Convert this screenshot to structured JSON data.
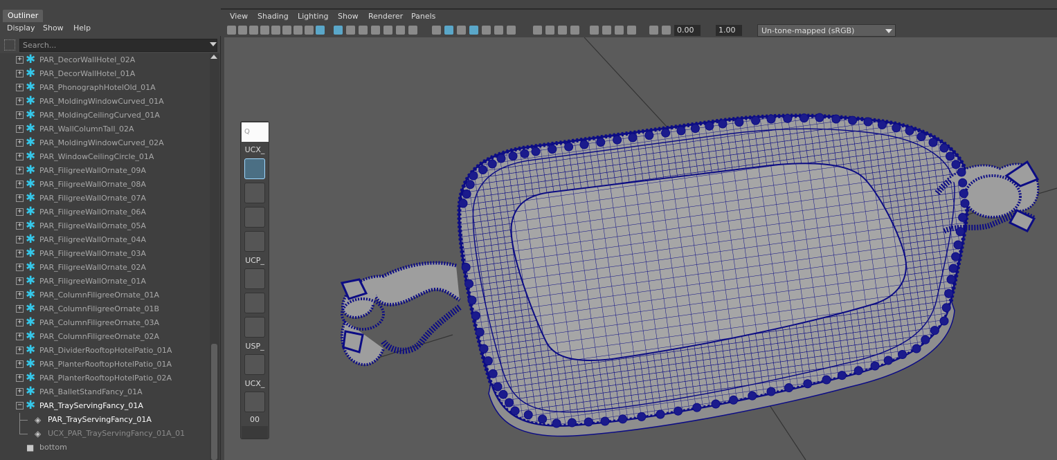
{
  "outliner": {
    "tab_label": "Outliner",
    "menu": [
      "Display",
      "Show",
      "Help"
    ],
    "search_placeholder": "Search...",
    "items": [
      {
        "label": "PAR_DecorWallHotel_02A"
      },
      {
        "label": "PAR_DecorWallHotel_01A"
      },
      {
        "label": "PAR_PhonographHotelOld_01A"
      },
      {
        "label": "PAR_MoldingWindowCurved_01A"
      },
      {
        "label": "PAR_MoldingCeilingCurved_01A"
      },
      {
        "label": "PAR_WallColumnTall_02A"
      },
      {
        "label": "PAR_MoldingWindowCurved_02A"
      },
      {
        "label": "PAR_WindowCeilingCircle_01A"
      },
      {
        "label": "PAR_FiligreeWallOrnate_09A"
      },
      {
        "label": "PAR_FiligreeWallOrnate_08A"
      },
      {
        "label": "PAR_FiligreeWallOrnate_07A"
      },
      {
        "label": "PAR_FiligreeWallOrnate_06A"
      },
      {
        "label": "PAR_FiligreeWallOrnate_05A"
      },
      {
        "label": "PAR_FiligreeWallOrnate_04A"
      },
      {
        "label": "PAR_FiligreeWallOrnate_03A"
      },
      {
        "label": "PAR_FiligreeWallOrnate_02A"
      },
      {
        "label": "PAR_FiligreeWallOrnate_01A"
      },
      {
        "label": "PAR_ColumnFiligreeOrnate_01A"
      },
      {
        "label": "PAR_ColumnFiligreeOrnate_01B"
      },
      {
        "label": "PAR_ColumnFiligreeOrnate_03A"
      },
      {
        "label": "PAR_ColumnFiligreeOrnate_02A"
      },
      {
        "label": "PAR_DividerRooftopHotelPatio_01A"
      },
      {
        "label": "PAR_PlanterRooftopHotelPatio_01A"
      },
      {
        "label": "PAR_PlanterRooftopHotelPatio_02A"
      },
      {
        "label": "PAR_BalletStandFancy_01A"
      },
      {
        "label": "PAR_TrayServingFancy_01A"
      }
    ],
    "children": [
      {
        "label": "PAR_TrayServingFancy_01A"
      },
      {
        "label": "UCX_PAR_TrayServingFancy_01A_01"
      }
    ],
    "camera_bottom": "bottom"
  },
  "viewport": {
    "menu": [
      "View",
      "Shading",
      "Lighting",
      "Show",
      "Renderer",
      "Panels"
    ],
    "exposure": "0.00",
    "gamma": "1.00",
    "color_management": "Un-tone-mapped (sRGB)"
  },
  "shelf": {
    "search_placeholder": "Q",
    "section_ucx": "UCX_",
    "section_ucp": "UCP_",
    "section_usp": "USP_",
    "section_ucx2": "UCX_",
    "footer": "00"
  },
  "colors": {
    "wireframe": "#0c0c84",
    "mesh_fill": "#a0a0a0",
    "viewport_bg": "#5b5b5b",
    "transform_icon": "#35c6e8"
  }
}
